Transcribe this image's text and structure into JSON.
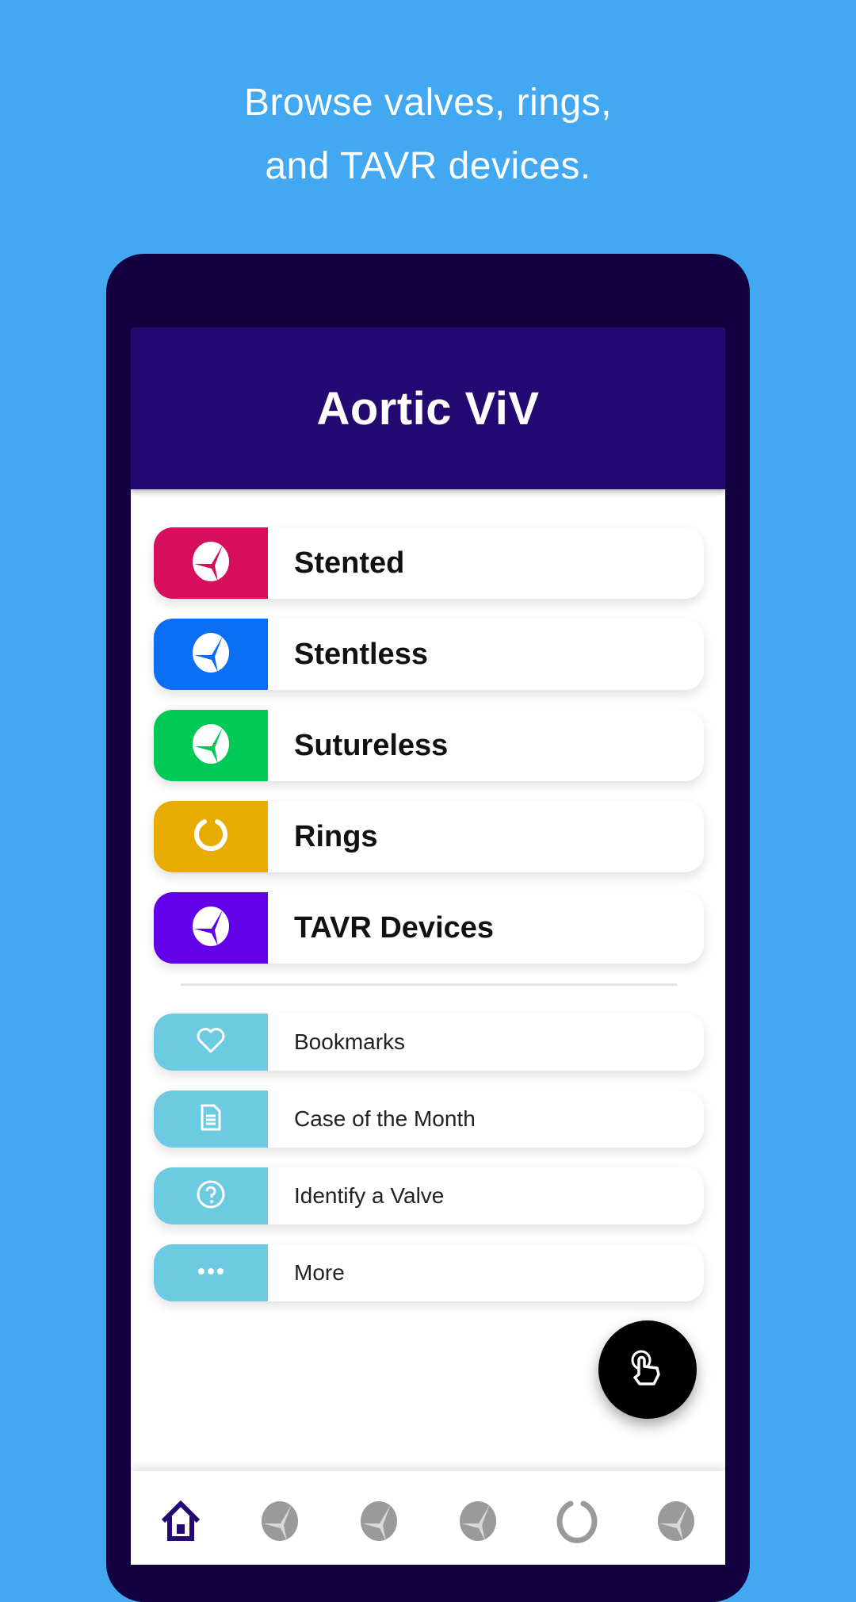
{
  "promo": {
    "line1": "Browse valves, rings,",
    "line2": "and TAVR devices."
  },
  "app": {
    "title": "Aortic ViV"
  },
  "categories": [
    {
      "label": "Stented",
      "icon": "valve-icon",
      "color": "#d70e5b"
    },
    {
      "label": "Stentless",
      "icon": "valve-icon",
      "color": "#0a6ff5"
    },
    {
      "label": "Sutureless",
      "icon": "valve-icon",
      "color": "#00c955"
    },
    {
      "label": "Rings",
      "icon": "ring-icon",
      "color": "#e8ab00"
    },
    {
      "label": "TAVR Devices",
      "icon": "valve-icon",
      "color": "#6200ea"
    }
  ],
  "links": [
    {
      "label": "Bookmarks",
      "icon": "heart-icon"
    },
    {
      "label": "Case of the Month",
      "icon": "document-icon"
    },
    {
      "label": "Identify a Valve",
      "icon": "question-icon"
    },
    {
      "label": "More",
      "icon": "more-dots-icon"
    }
  ],
  "colors": {
    "background": "#42a8f2",
    "phone_frame": "#120040",
    "app_bar": "#230a72",
    "link_swatch": "#6ccbe0",
    "nav_active": "#230a72",
    "nav_inactive": "#9a9a9a"
  },
  "fab": {
    "icon": "touch-gesture-icon"
  },
  "bottom_nav": [
    {
      "name": "home",
      "icon": "home-icon",
      "active": true
    },
    {
      "name": "stented",
      "icon": "valve-icon",
      "active": false
    },
    {
      "name": "stentless",
      "icon": "valve-icon",
      "active": false
    },
    {
      "name": "sutureless",
      "icon": "valve-icon",
      "active": false
    },
    {
      "name": "rings",
      "icon": "ring-icon",
      "active": false
    },
    {
      "name": "tavr",
      "icon": "valve-icon",
      "active": false
    }
  ]
}
